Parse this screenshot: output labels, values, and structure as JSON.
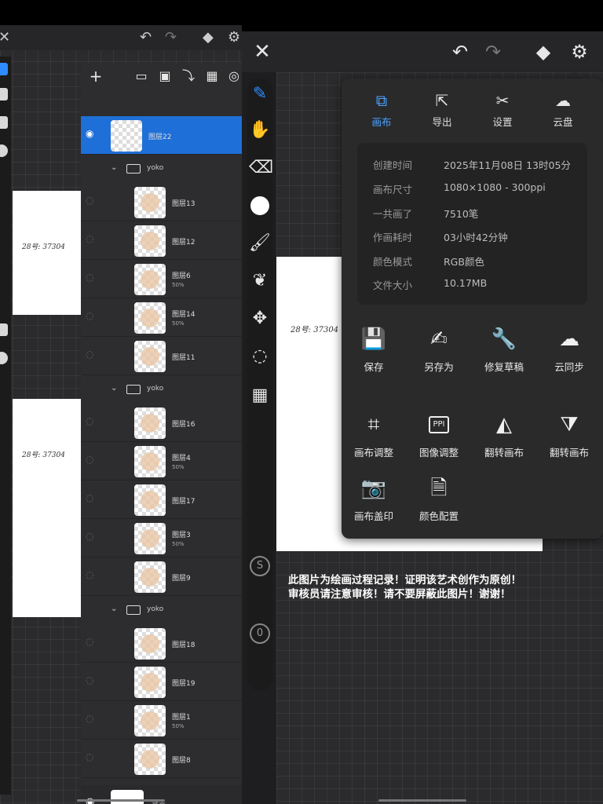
{
  "left_panel": {
    "signature": "28号: 37304",
    "layers": [
      {
        "name": "图层22",
        "opacity": "",
        "selected": true
      },
      {
        "group": "yoko"
      },
      {
        "name": "图层13",
        "opacity": ""
      },
      {
        "name": "图层12",
        "opacity": ""
      },
      {
        "name": "图层6",
        "opacity": "50%"
      },
      {
        "name": "图层14",
        "opacity": "50%"
      },
      {
        "name": "图层11",
        "opacity": ""
      },
      {
        "group": "yoko"
      },
      {
        "name": "图层16",
        "opacity": ""
      },
      {
        "name": "图层4",
        "opacity": "50%"
      },
      {
        "name": "图层17",
        "opacity": ""
      },
      {
        "name": "图层3",
        "opacity": "50%"
      },
      {
        "name": "图层9",
        "opacity": ""
      },
      {
        "group": "yoko"
      },
      {
        "name": "图层18",
        "opacity": ""
      },
      {
        "name": "图层19",
        "opacity": ""
      },
      {
        "name": "图层1",
        "opacity": "50%"
      },
      {
        "name": "图层8",
        "opacity": ""
      }
    ],
    "background_layer": "背景"
  },
  "main": {
    "signature": "28号: 37304",
    "tabs": [
      {
        "label": "画布",
        "icon": "canvas-icon",
        "active": true
      },
      {
        "label": "导出",
        "icon": "export-icon",
        "active": false
      },
      {
        "label": "设置",
        "icon": "settings-tools-icon",
        "active": false
      },
      {
        "label": "云盘",
        "icon": "cloud-drive-icon",
        "active": false
      }
    ],
    "info": [
      {
        "key": "创建时间",
        "value": "2025年11月08日 13时05分"
      },
      {
        "key": "画布尺寸",
        "value": "1080×1080 - 300ppi"
      },
      {
        "key": "一共画了",
        "value": "7510笔"
      },
      {
        "key": "作画耗时",
        "value": "03小时42分钟"
      },
      {
        "key": "颜色模式",
        "value": "RGB颜色"
      },
      {
        "key": "文件大小",
        "value": "10.17MB"
      }
    ],
    "actions": [
      {
        "label": "保存",
        "icon": "save-icon"
      },
      {
        "label": "另存为",
        "icon": "save-as-icon"
      },
      {
        "label": "修复草稿",
        "icon": "wrench-icon"
      },
      {
        "label": "云同步",
        "icon": "cloud-sync-icon"
      },
      {
        "label": "画布调整",
        "icon": "crop-icon"
      },
      {
        "label": "图像调整",
        "icon": "ppi-icon"
      },
      {
        "label": "翻转画布",
        "icon": "flip-horizontal-icon"
      },
      {
        "label": "翻转画布",
        "icon": "flip-vertical-icon"
      },
      {
        "label": "画布盖印",
        "icon": "stamp-camera-icon"
      },
      {
        "label": "颜色配置",
        "icon": "color-profile-icon"
      }
    ],
    "notice_line1": "此图片为绘画过程记录！证明该艺术创作为原创！",
    "notice_line2": "审核员请注意审核！请不要屏蔽此图片！谢谢！",
    "tool_s": "S",
    "tool_0": "0"
  }
}
